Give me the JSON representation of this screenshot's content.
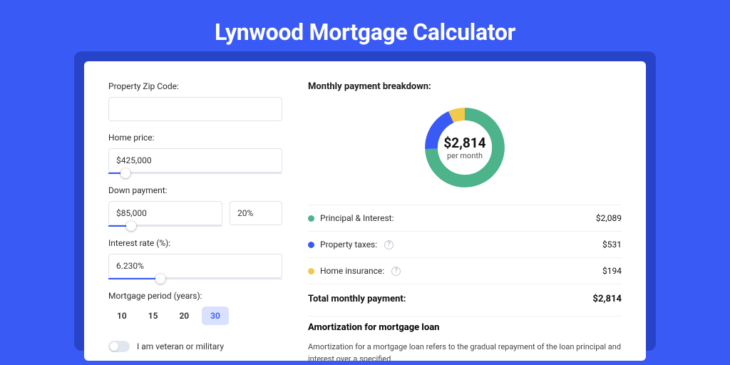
{
  "title": "Lynwood Mortgage Calculator",
  "colors": {
    "accent": "#3a5af5",
    "green": "#4cb38a",
    "blue": "#3a5af5",
    "yellow": "#f2c94c"
  },
  "form": {
    "zip_label": "Property Zip Code:",
    "zip_value": "",
    "home_price_label": "Home price:",
    "home_price_value": "$425,000",
    "home_price_slider_pct": 10,
    "down_payment_label": "Down payment:",
    "down_payment_value": "$85,000",
    "down_payment_pct": "20%",
    "down_payment_slider_pct": 20,
    "interest_label": "Interest rate (%):",
    "interest_value": "6.230%",
    "interest_slider_pct": 30,
    "period_label": "Mortgage period (years):",
    "periods": [
      {
        "label": "10",
        "active": false
      },
      {
        "label": "15",
        "active": false
      },
      {
        "label": "20",
        "active": false
      },
      {
        "label": "30",
        "active": true
      }
    ],
    "veteran_label": "I am veteran or military"
  },
  "breakdown": {
    "title": "Monthly payment breakdown:",
    "center_value": "$2,814",
    "center_sub": "per month",
    "items": [
      {
        "color": "green",
        "label": "Principal & Interest:",
        "value": "$2,089",
        "help": false
      },
      {
        "color": "blue",
        "label": "Property taxes:",
        "value": "$531",
        "help": true
      },
      {
        "color": "yellow",
        "label": "Home insurance:",
        "value": "$194",
        "help": true
      }
    ],
    "total_label": "Total monthly payment:",
    "total_value": "$2,814"
  },
  "chart_data": {
    "type": "pie",
    "title": "Monthly payment breakdown",
    "series": [
      {
        "name": "Principal & Interest",
        "value": 2089,
        "color": "#4cb38a"
      },
      {
        "name": "Property taxes",
        "value": 531,
        "color": "#3a5af5"
      },
      {
        "name": "Home insurance",
        "value": 194,
        "color": "#f2c94c"
      }
    ],
    "total": 2814,
    "unit": "USD/month"
  },
  "amortization": {
    "title": "Amortization for mortgage loan",
    "text": "Amortization for a mortgage loan refers to the gradual repayment of the loan principal and interest over a specified"
  }
}
